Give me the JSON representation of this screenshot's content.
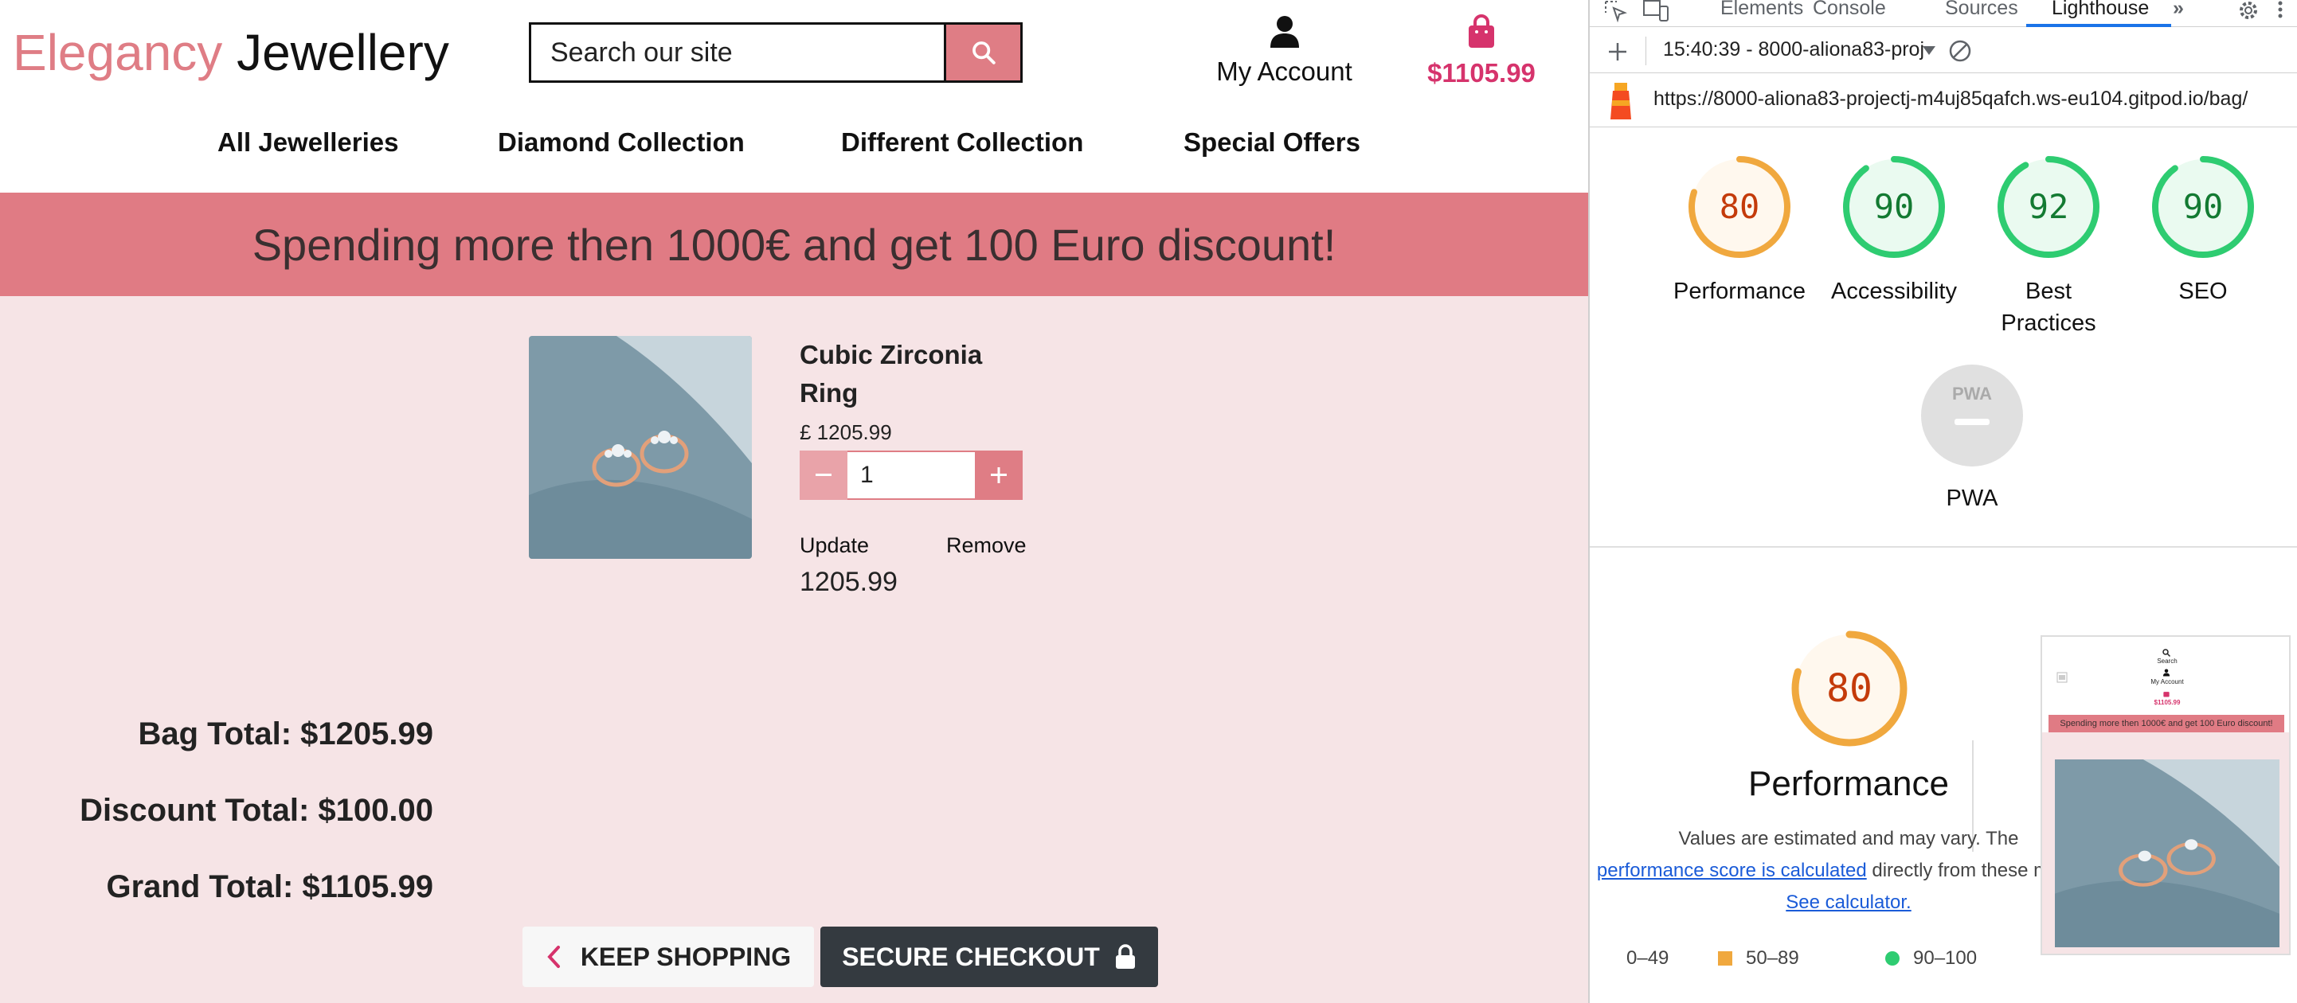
{
  "site": {
    "brand_part1": "Elegancy",
    "brand_part2": "Jewellery",
    "search_placeholder": "Search our site",
    "account_label": "My Account",
    "bag_amount": "$1105.99",
    "nav": [
      "All Jewelleries",
      "Diamond Collection",
      "Different Collection",
      "Special Offers"
    ],
    "banner": "Spending more then 1000€ and get 100 Euro discount!",
    "product": {
      "name": "Cubic Zirconia Ring",
      "price": "£ 1205.99",
      "quantity": "1",
      "update_label": "Update",
      "remove_label": "Remove",
      "subtotal": "1205.99"
    },
    "totals": {
      "bag": "Bag Total: $1205.99",
      "discount": "Discount Total: $100.00",
      "grand": "Grand Total: $1105.99"
    },
    "buttons": {
      "keep_shopping": "KEEP SHOPPING",
      "secure_checkout": "SECURE CHECKOUT"
    },
    "colors": {
      "brand_pink": "#df7d85",
      "bag_pink": "#d6336c",
      "banner": "#e07b84",
      "page_bg": "#f6e4e6",
      "dark_button": "#343a40"
    }
  },
  "devtools": {
    "tabs": [
      "Elements",
      "Console",
      "Sources",
      "Lighthouse"
    ],
    "active_tab": "Lighthouse",
    "run_label": "15:40:39 - 8000-aliona83-proj",
    "url": "https://8000-aliona83-projectj-m4uj85qafch.ws-eu104.gitpod.io/bag/",
    "scores": [
      {
        "label": "Performance",
        "value": "80",
        "level": "average"
      },
      {
        "label": "Accessibility",
        "value": "90",
        "level": "pass"
      },
      {
        "label": "Best Practices",
        "value": "92",
        "level": "pass"
      },
      {
        "label": "SEO",
        "value": "90",
        "level": "pass"
      }
    ],
    "pwa_label": "PWA",
    "pwa_badge": "PWA",
    "performance": {
      "score": "80",
      "title": "Performance",
      "desc_1": "Values are estimated and may vary. The",
      "desc_link": "performance score is calculated",
      "desc_2": "directly from these metrics.",
      "calc_link": "See calculator."
    },
    "legend": [
      "0–49",
      "50–89",
      "90–100"
    ],
    "thumbnail": {
      "search": "Search",
      "account": "My Account",
      "amount": "$1105.99",
      "banner": "Spending more then 1000€ and get 100 Euro discount!"
    },
    "colors": {
      "average": "#f0a83e",
      "pass": "#22a24a",
      "fail": "#e33",
      "link": "#1a5bd8"
    }
  }
}
